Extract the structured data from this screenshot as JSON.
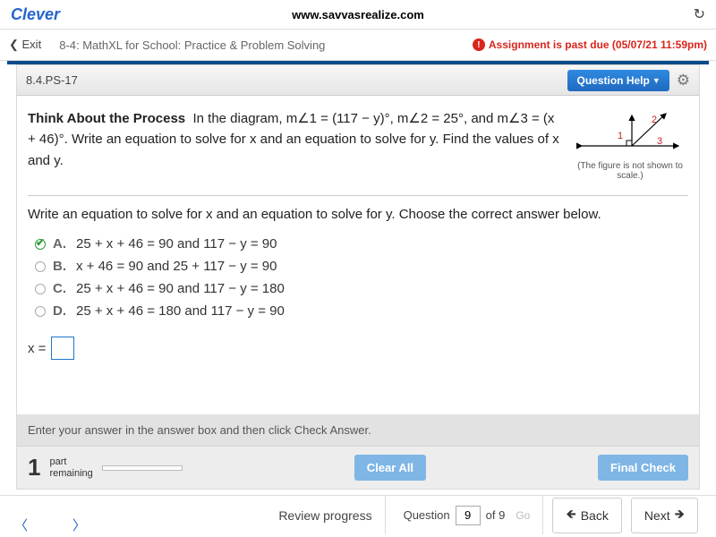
{
  "header": {
    "logo": "Clever",
    "url": "www.savvasrealize.com"
  },
  "assignment": {
    "exit": "Exit",
    "title": "8-4: MathXL for School: Practice & Problem Solving",
    "pastdue": "Assignment is past due (05/07/21 11:59pm)"
  },
  "question": {
    "id": "8.4.PS-17",
    "help_label": "Question Help",
    "process_label": "Think About the Process",
    "text_part1": "In the diagram, m∠1 = (117 − y)°, m∠2 = 25°, and m∠3 = (x + 46)°. Write an equation to solve for x and an equation to solve for y. Find the values of x and y.",
    "figure_caption": "(The figure is not shown to scale.)",
    "subprompt": "Write an equation to solve for x and an equation to solve for y. Choose the correct answer below.",
    "choices": [
      {
        "letter": "A.",
        "text": "25 + x + 46 = 90 and 117 − y = 90",
        "checked": true
      },
      {
        "letter": "B.",
        "text": "x + 46 = 90 and 25 + 117 − y = 90",
        "checked": false
      },
      {
        "letter": "C.",
        "text": "25 + x + 46 = 90 and 117 − y = 180",
        "checked": false
      },
      {
        "letter": "D.",
        "text": "25 + x + 46 = 180 and 117 − y = 90",
        "checked": false
      }
    ],
    "x_label": "x =",
    "angle_labels": {
      "a1": "1",
      "a2": "2",
      "a3": "3"
    }
  },
  "instructions": "Enter your answer in the answer box and then click Check Answer.",
  "progress": {
    "count": "1",
    "part_label": "part",
    "remaining_label": "remaining",
    "clear_label": "Clear All",
    "final_label": "Final Check"
  },
  "nav": {
    "review": "Review progress",
    "question_label": "Question",
    "current": "9",
    "of_label": "of 9",
    "go": "Go",
    "back": "Back",
    "next": "Next"
  }
}
